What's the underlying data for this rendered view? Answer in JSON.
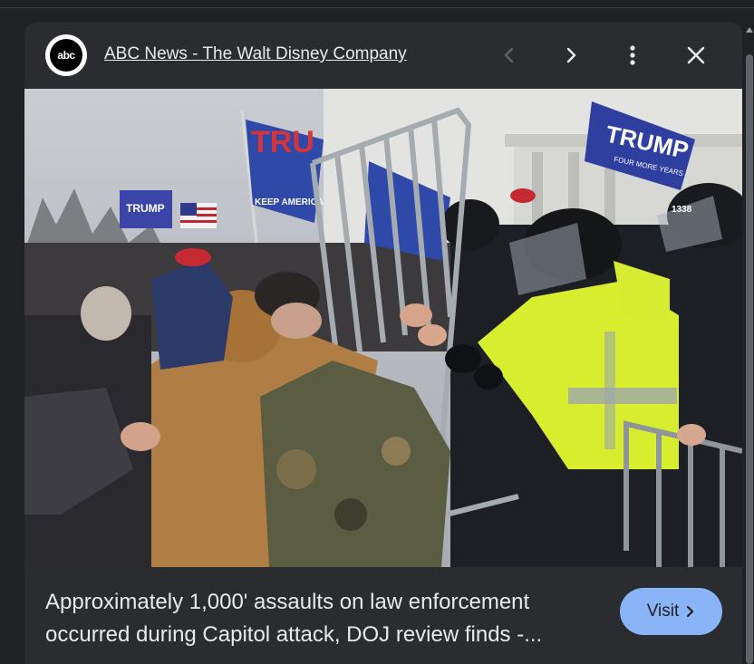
{
  "source": {
    "logo_text": "abc",
    "name": "ABC News - The Walt Disney Company"
  },
  "header_controls": {
    "prev_icon": "chevron-left-icon",
    "next_icon": "chevron-right-icon",
    "more_icon": "more-vert-icon",
    "close_icon": "close-icon"
  },
  "image": {
    "lens_icon": "google-lens-icon",
    "sign_text_1": "TRUMP",
    "sign_text_2": "FOUR MORE YEARS",
    "sign_text_3": "TRUMP",
    "sign_text_4": "KEEP AMERICA",
    "helmet_number": "1338"
  },
  "caption": {
    "line1": "Approximately 1,000' assaults on law enforcement",
    "line2": "occurred during Capitol attack, DOJ review finds -..."
  },
  "visit_button": {
    "label": "Visit",
    "icon": "chevron-right-icon"
  },
  "colors": {
    "accent": "#8ab4f8",
    "panel": "#2b2c2f",
    "page": "#202124"
  }
}
